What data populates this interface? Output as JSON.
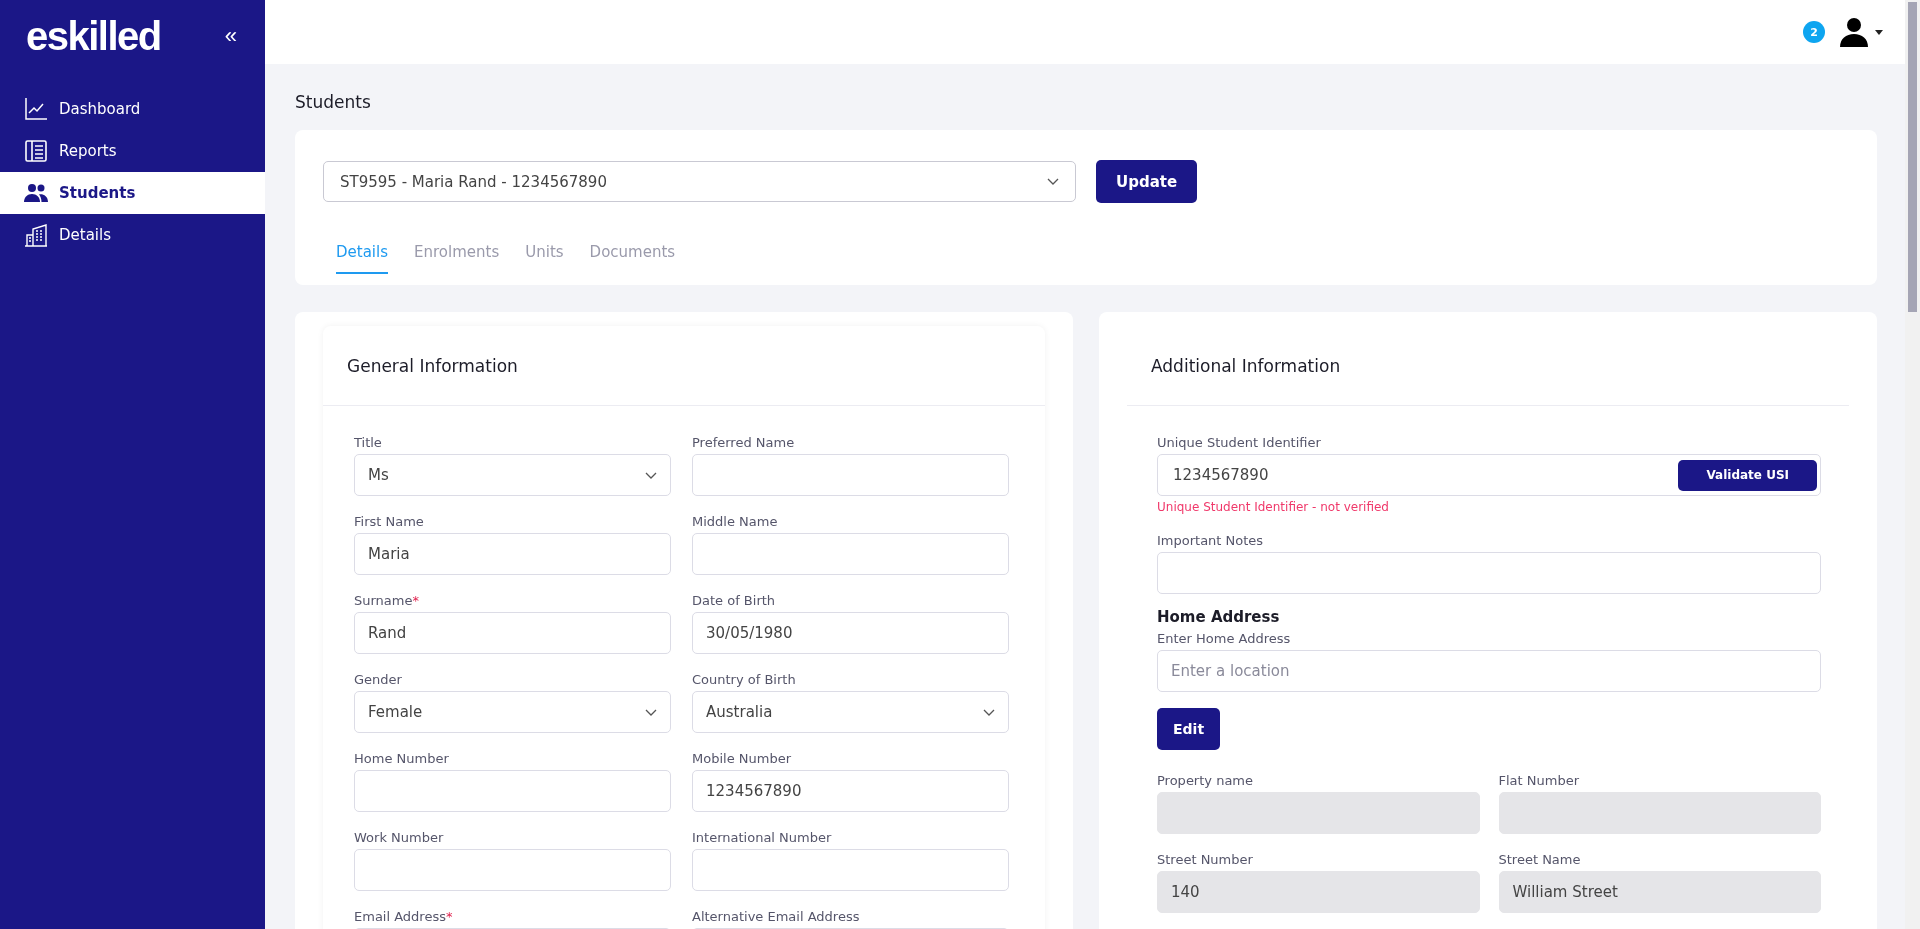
{
  "sidebar": {
    "logo": "eskilled",
    "collapse": "«",
    "items": [
      {
        "label": "Dashboard",
        "selected": false
      },
      {
        "label": "Reports",
        "selected": false
      },
      {
        "label": "Students",
        "selected": true
      },
      {
        "label": "Details",
        "selected": false
      }
    ]
  },
  "header": {
    "notification_count": "2"
  },
  "page_title": "Students",
  "student_select": {
    "value": "ST9595 - Maria Rand - 1234567890"
  },
  "update_button": "Update",
  "tabs": [
    {
      "label": "Details",
      "selected": true
    },
    {
      "label": "Enrolments",
      "selected": false
    },
    {
      "label": "Units",
      "selected": false
    },
    {
      "label": "Documents",
      "selected": false
    }
  ],
  "general_information": {
    "title": "General Information",
    "fields": [
      {
        "label": "Title",
        "kind": "select",
        "value": "Ms"
      },
      {
        "label": "Preferred Name",
        "kind": "text"
      },
      {
        "label": "First Name",
        "kind": "text",
        "value": "Maria"
      },
      {
        "label": "Middle Name",
        "kind": "text"
      },
      {
        "label": "Surname",
        "kind": "text",
        "value": "Rand",
        "required_mark": "*"
      },
      {
        "label": "Date of Birth",
        "kind": "text",
        "value": "30/05/1980"
      },
      {
        "label": "Gender",
        "kind": "select",
        "value": "Female"
      },
      {
        "label": "Country of Birth",
        "kind": "select",
        "value": "Australia"
      },
      {
        "label": "Home Number",
        "kind": "text"
      },
      {
        "label": "Mobile Number",
        "kind": "text",
        "value": "1234567890"
      },
      {
        "label": "Work Number",
        "kind": "text"
      },
      {
        "label": "International Number",
        "kind": "text"
      },
      {
        "label": "Email Address",
        "kind": "text",
        "required_mark": "*"
      },
      {
        "label": "Alternative Email Address",
        "kind": "text"
      }
    ]
  },
  "additional_information": {
    "title": "Additional Information",
    "usi": {
      "label": "Unique Student Identifier",
      "value": "1234567890",
      "button": "Validate USI",
      "error": "Unique Student Identifier - not verified"
    },
    "important_notes": {
      "label": "Important Notes"
    },
    "home_address": {
      "heading": "Home Address",
      "label": "Enter Home Address",
      "placeholder": "Enter a location",
      "edit_button": "Edit",
      "fields": [
        {
          "label": "Property name",
          "disabled": true
        },
        {
          "label": "Flat Number",
          "disabled": true
        },
        {
          "label": "Street Number",
          "value": "140",
          "disabled": true
        },
        {
          "label": "Street Name",
          "value": "William Street",
          "disabled": true
        }
      ]
    }
  }
}
